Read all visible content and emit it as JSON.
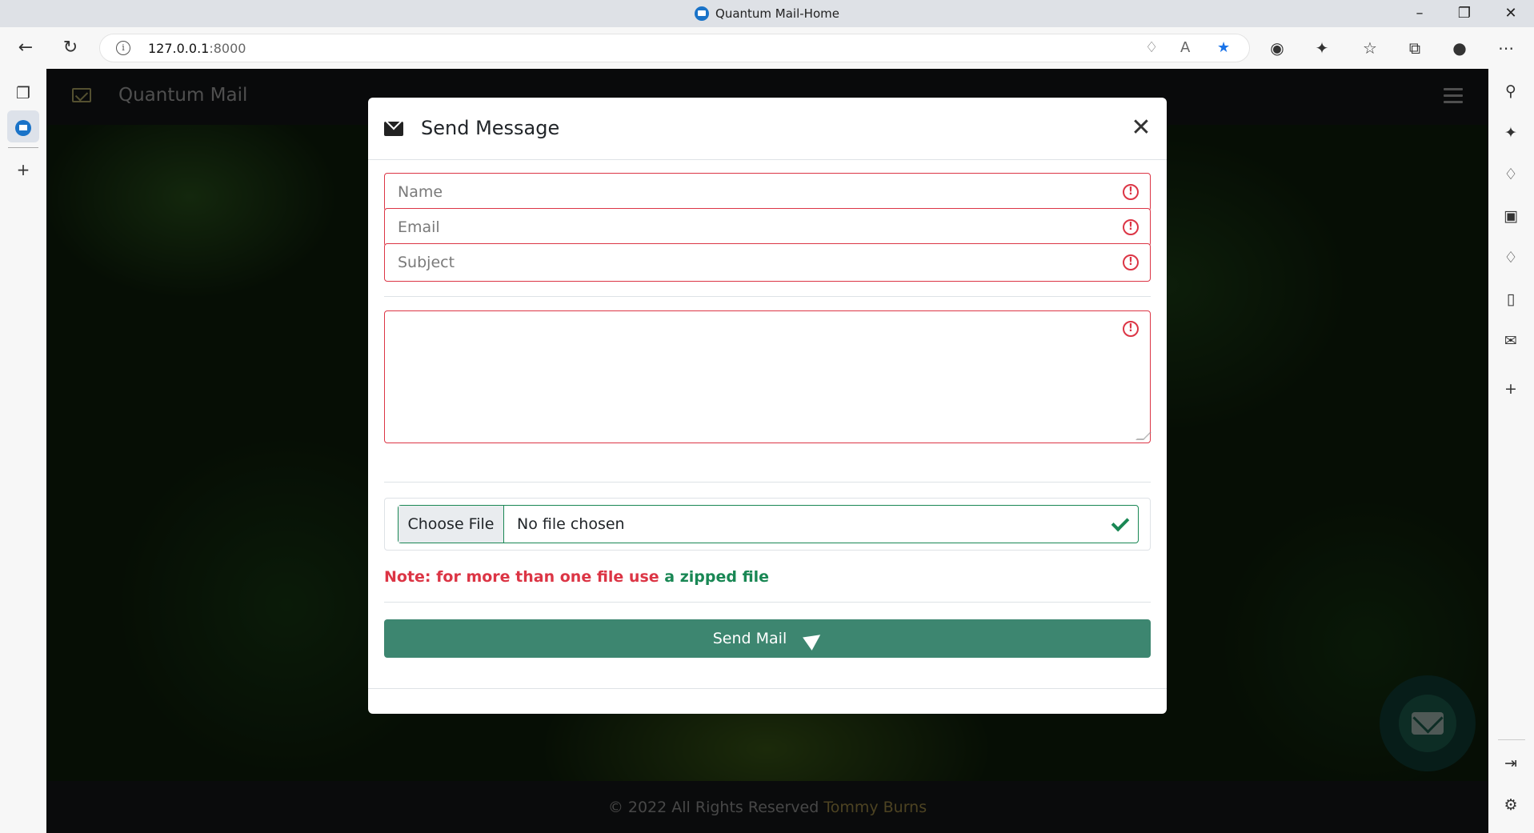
{
  "browser": {
    "window_title": "Quantum Mail-Home",
    "url_host": "127.0.0.1",
    "url_port": ":8000"
  },
  "app": {
    "brand": "Quantum Mail",
    "footer_text": "© 2022 All Rights Reserved",
    "footer_author": "Tommy Burns"
  },
  "modal": {
    "title": "Send Message",
    "name_placeholder": "Name",
    "email_placeholder": "Email",
    "subject_placeholder": "Subject",
    "message_value": "",
    "choose_file_label": "Choose File",
    "no_file_text": "No file chosen",
    "note_text": "Note: for more than one file use",
    "note_highlight": "a zipped file",
    "send_label": "Send Mail"
  },
  "colors": {
    "accent": "#3d8670",
    "error": "#dc3545",
    "success": "#198754",
    "brand_icon": "#a8a060"
  }
}
